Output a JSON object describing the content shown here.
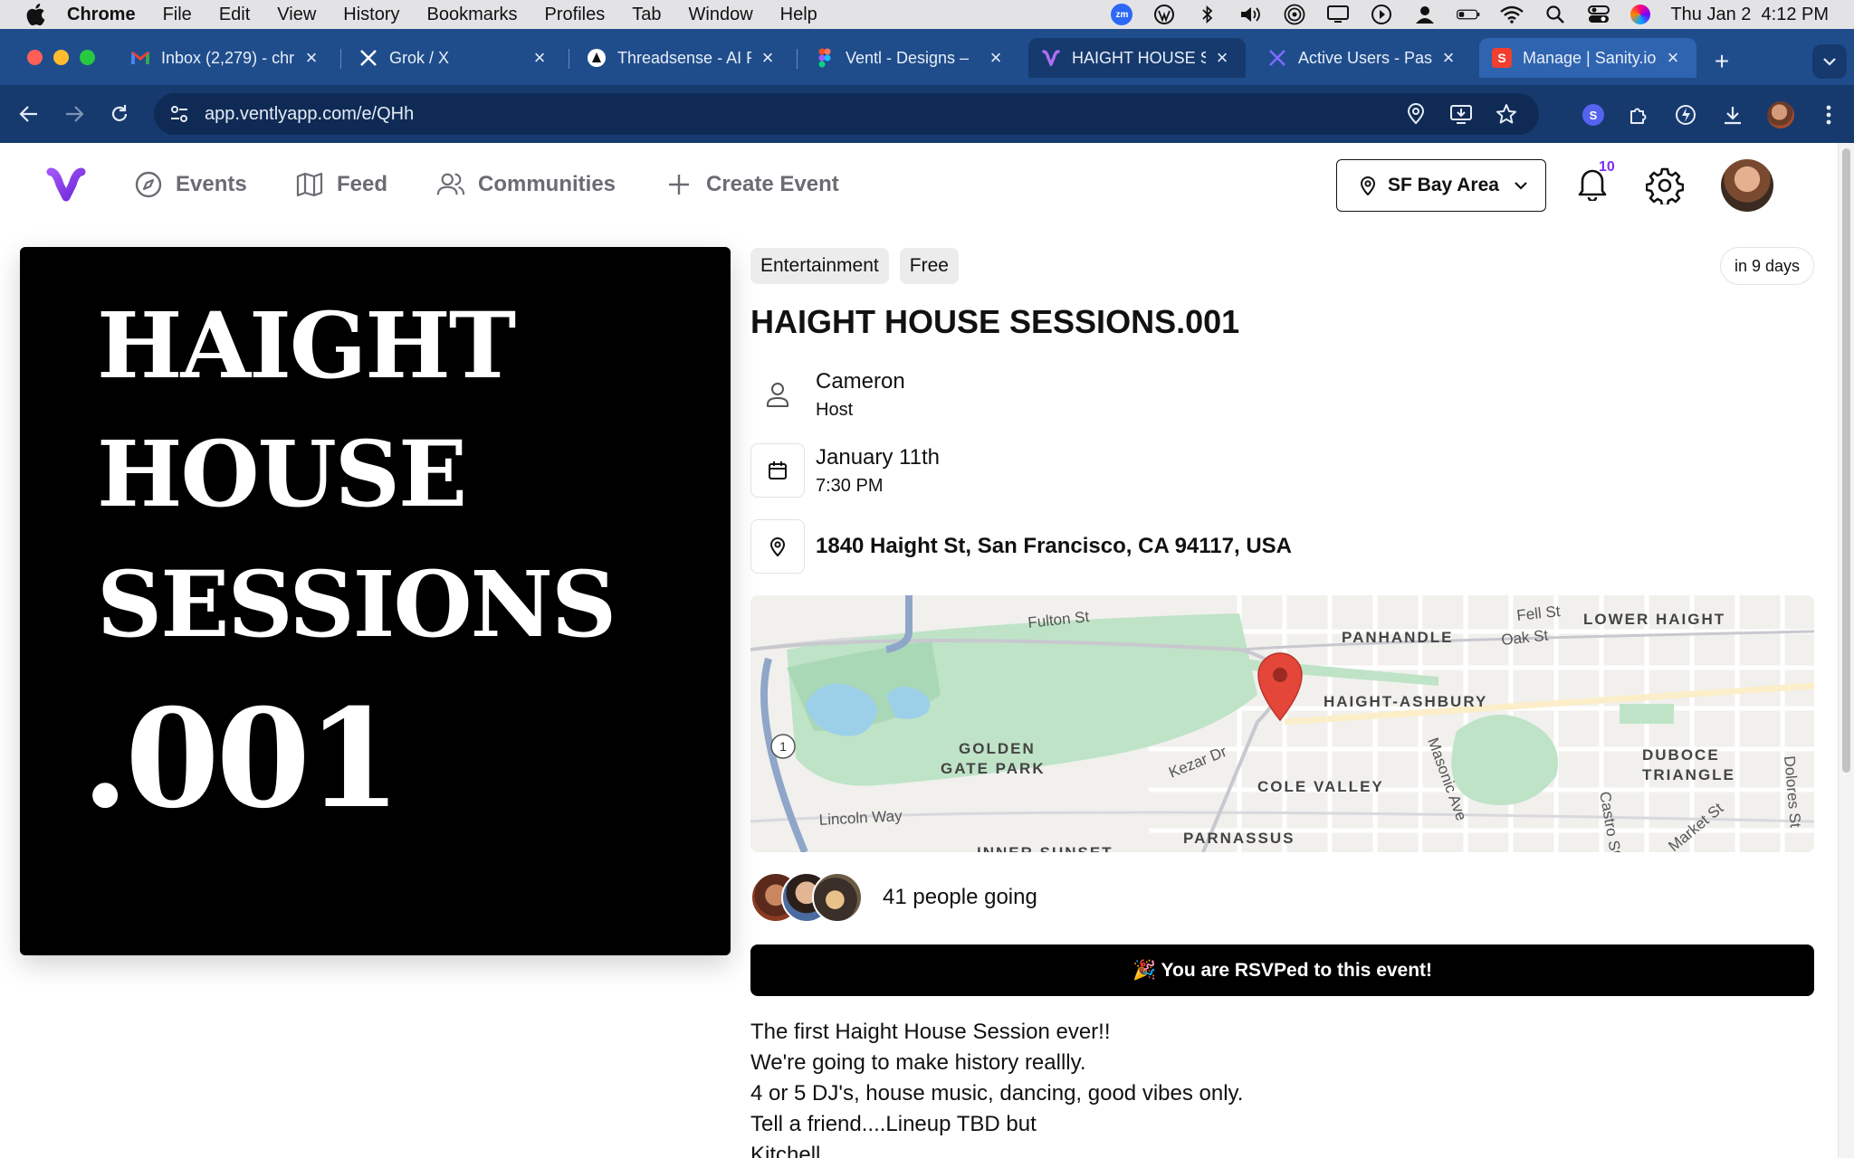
{
  "menubar": {
    "app": "Chrome",
    "items": [
      "File",
      "Edit",
      "View",
      "History",
      "Bookmarks",
      "Profiles",
      "Tab",
      "Window",
      "Help"
    ],
    "clock": "Thu Jan 2  4:12 PM",
    "zoom_badge": "zm"
  },
  "browser": {
    "tabs": [
      {
        "title": "Inbox (2,279) - chr",
        "icon": "gmail-icon"
      },
      {
        "title": "Grok / X",
        "icon": "x-icon"
      },
      {
        "title": "Threadsense - AI F",
        "icon": "threadsense-icon"
      },
      {
        "title": "Ventl - Designs –",
        "icon": "figma-icon"
      },
      {
        "title": "HAIGHT HOUSE SE",
        "icon": "ventl-icon"
      },
      {
        "title": "Active Users - Pas",
        "icon": "passage-icon"
      },
      {
        "title": "Manage | Sanity.io",
        "icon": "sanity-icon"
      }
    ],
    "url": "app.ventlyapp.com/e/QHh",
    "extension_badge": "S"
  },
  "nav": {
    "links": [
      "Events",
      "Feed",
      "Communities",
      "Create Event"
    ],
    "location": "SF Bay Area",
    "notification_count": "10"
  },
  "poster": {
    "lines": [
      "HAIGHT",
      "HOUSE",
      "SESSIONS",
      ".001"
    ]
  },
  "event": {
    "tags": [
      "Entertainment",
      "Free"
    ],
    "relative_time": "in 9 days",
    "title": "HAIGHT HOUSE SESSIONS.001",
    "host_name": "Cameron",
    "host_label": "Host",
    "date": "January 11th",
    "time": "7:30 PM",
    "address": "1840 Haight St, San Francisco, CA 94117, USA",
    "attendance": "41 people going",
    "rsvp_status": "🎉 You are RSVPed to this event!",
    "description": [
      "The first Haight House Session ever!!",
      "We're going to make history reallly.",
      "4 or 5 DJ's, house music, dancing, good vibes only.",
      "Tell a friend....Lineup TBD but",
      "Kitchell"
    ]
  },
  "map": {
    "labels": [
      "Fulton St",
      "PANHANDLE",
      "Fell St",
      "Oak St",
      "LOWER HAIGHT",
      "HAIGHT-ASHBURY",
      "GOLDEN",
      "GATE PARK",
      "Kezar Dr",
      "COLE VALLEY",
      "Masonic Ave",
      "DUBOCE",
      "TRIANGLE",
      "Dolores St",
      "Castro St",
      "Market St",
      "Lincoln Way",
      "PARNASSUS",
      "INNER SUNSET",
      "1"
    ]
  },
  "colors": {
    "accent": "#7b2ff0",
    "tab_strip": "#1f4d8c",
    "toolbar": "#163a6e",
    "park_green": "#bfe3c7",
    "pin_red": "#e4473a"
  }
}
